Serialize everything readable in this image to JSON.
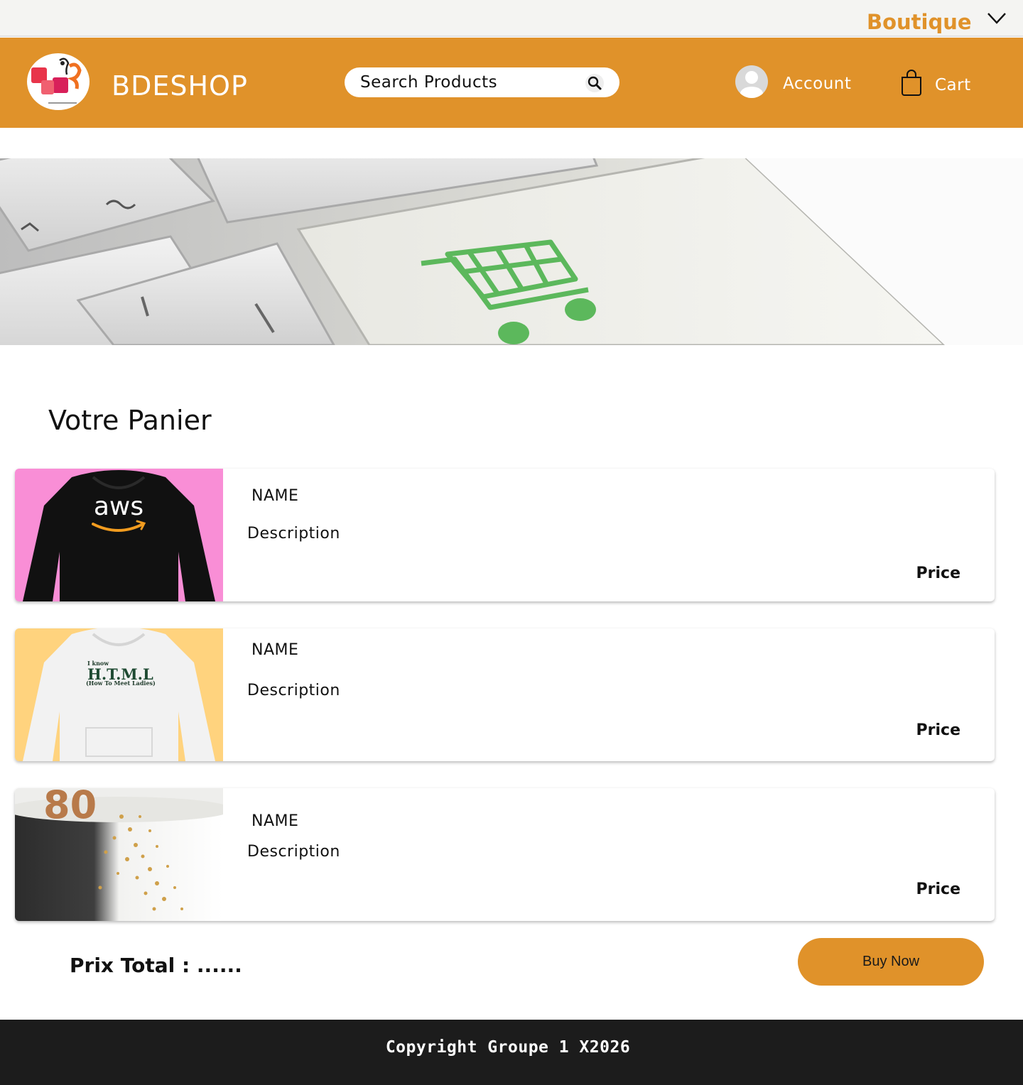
{
  "topbar": {
    "boutique_label": "Boutique"
  },
  "header": {
    "brand": "BDESHOP",
    "search_placeholder": "Search Products",
    "account_label": "Account",
    "cart_label": "Cart"
  },
  "main": {
    "title": "Votre Panier",
    "items": [
      {
        "name": "NAME",
        "description": "Description",
        "price": "Price"
      },
      {
        "name": "NAME",
        "description": "Description",
        "price": "Price"
      },
      {
        "name": "NAME",
        "description": "Description",
        "price": "Price"
      }
    ],
    "total_label": "Prix Total : ......",
    "buy_label": "Buy Now"
  },
  "footer": {
    "copyright": "Copyright Groupe 1 X2026"
  },
  "colors": {
    "accent": "#e0922a",
    "footer_bg": "#1c1c1c",
    "cart_icon_green": "#5cb85c"
  }
}
